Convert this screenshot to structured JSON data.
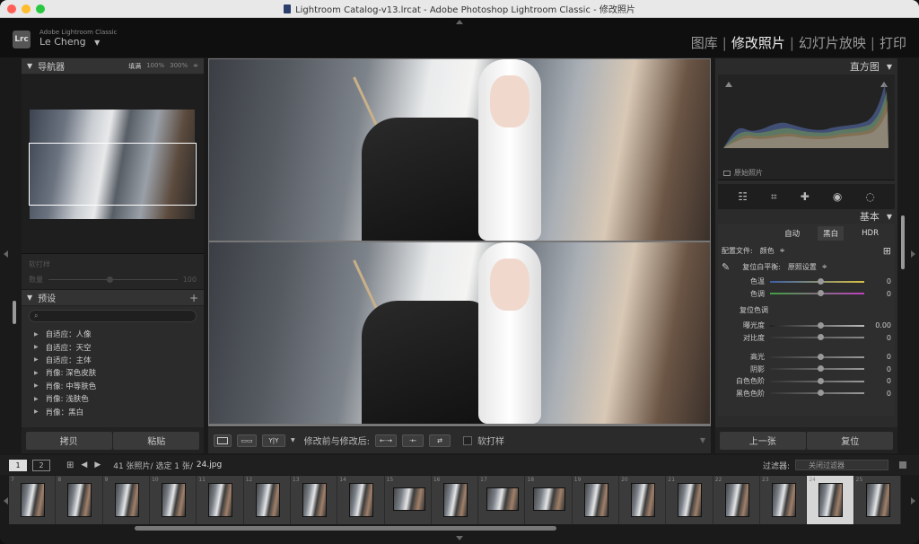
{
  "window": {
    "title": "Lightroom Catalog-v13.lrcat - Adobe Photoshop Lightroom Classic - 修改照片",
    "traffic": {
      "close": "#ff5f57",
      "min": "#febc2e",
      "max": "#28c840"
    }
  },
  "identity": {
    "logo": "Lrc",
    "app_name": "Adobe Lightroom Classic",
    "user": "Le Cheng",
    "user_arrow": "▼"
  },
  "modules": {
    "items": [
      "图库",
      "修改照片",
      "幻灯片放映",
      "打印"
    ],
    "active_index": 1,
    "separator": "|"
  },
  "navigator": {
    "title": "导航器",
    "options": [
      "填满",
      "100%",
      "300%",
      "≑"
    ]
  },
  "soft_panel": {
    "title": "软打样",
    "label": "数量",
    "value": "100"
  },
  "presets": {
    "title": "预设",
    "plus": "+",
    "items": [
      "自适应：人像",
      "自适应：天空",
      "自适应：主体",
      "肖像: 深色皮肤",
      "肖像: 中等肤色",
      "肖像: 浅肤色",
      "肖像：黑白"
    ]
  },
  "left_buttons": {
    "copy": "拷贝",
    "paste": "粘贴"
  },
  "toolbar": {
    "before_after_label": "修改前与修改后:",
    "soft_proof": "软打样",
    "yy": "Y|Y"
  },
  "histogram": {
    "title": "直方图",
    "original_photo": "原始照片"
  },
  "basic": {
    "title": "基本",
    "treatments": [
      "自动",
      "黑白",
      "HDR"
    ],
    "profile_label": "配置文件:",
    "profile_value": "颜色",
    "wb_label": "复位白平衡:",
    "wb_value": "原照设置",
    "tone_label": "复位色调",
    "sliders": [
      {
        "label": "色温",
        "value": "0"
      },
      {
        "label": "色调",
        "value": "0"
      }
    ],
    "tone_sliders": [
      {
        "label": "曝光度",
        "value": "0.00"
      },
      {
        "label": "对比度",
        "value": "0"
      }
    ],
    "light_sliders": [
      {
        "label": "高光",
        "value": "0"
      },
      {
        "label": "阴影",
        "value": "0"
      },
      {
        "label": "白色色阶",
        "value": "0"
      },
      {
        "label": "黑色色阶",
        "value": "0"
      }
    ]
  },
  "right_buttons": {
    "previous": "上一张",
    "reset": "复位"
  },
  "filmbar": {
    "monitor1": "1",
    "monitor2": "2",
    "info": "41 张照片/ 选定 1 张/",
    "filename": "24.jpg",
    "filter_label": "过滤器:",
    "filter_value": "关闭过滤器"
  },
  "filmstrip": {
    "numbers": [
      "7",
      "8",
      "9",
      "10",
      "11",
      "12",
      "13",
      "14",
      "15",
      "16",
      "17",
      "18",
      "19",
      "20",
      "21",
      "22",
      "23",
      "24",
      "25"
    ],
    "selected_index": 17
  }
}
